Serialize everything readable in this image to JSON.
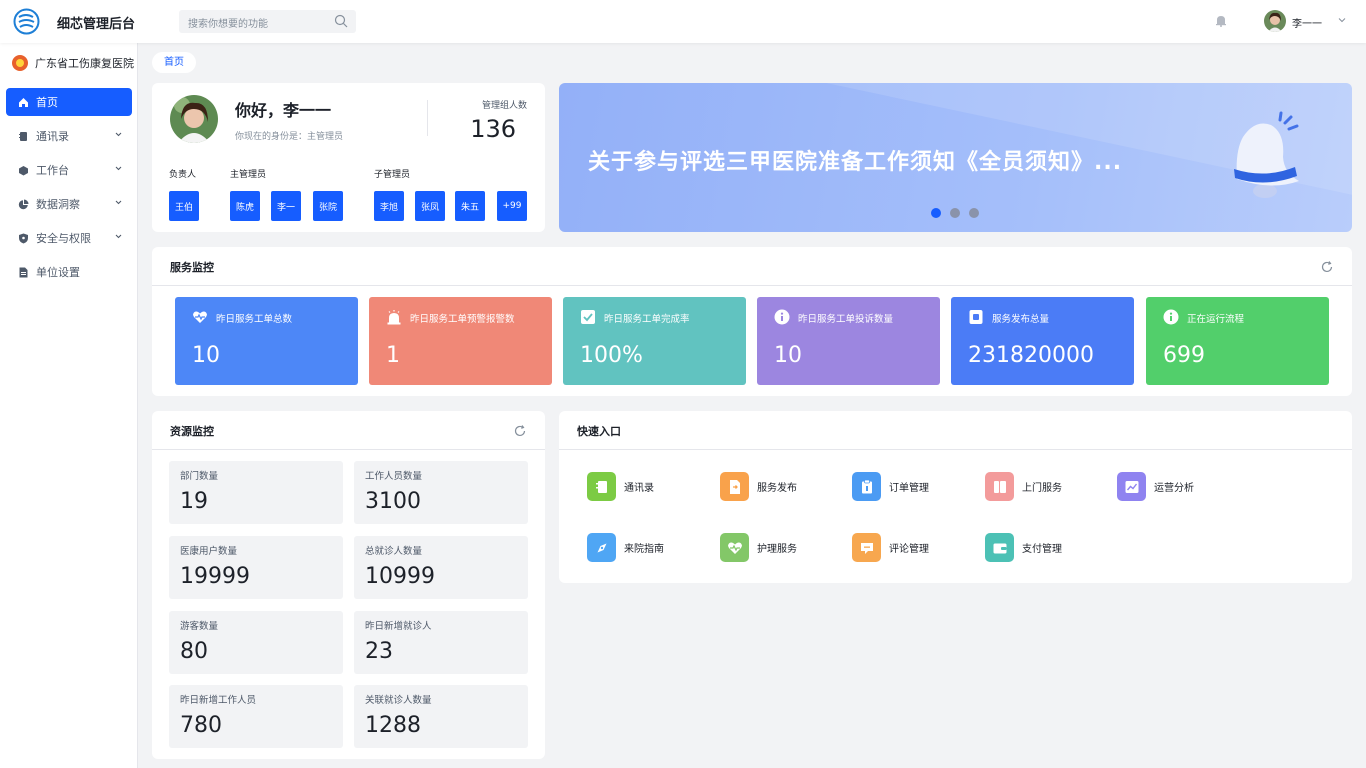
{
  "app": {
    "title": "细芯管理后台"
  },
  "search": {
    "placeholder": "搜索你想要的功能"
  },
  "user": {
    "name": "李一一"
  },
  "sidebar": {
    "org": "广东省工伤康复医院",
    "items": [
      {
        "label": "首页",
        "icon": "home-icon",
        "active": true
      },
      {
        "label": "通讯录",
        "icon": "contacts-icon",
        "expandable": true
      },
      {
        "label": "工作台",
        "icon": "cube-icon",
        "expandable": true
      },
      {
        "label": "数据洞察",
        "icon": "pie-chart-icon",
        "expandable": true
      },
      {
        "label": "安全与权限",
        "icon": "shield-icon",
        "expandable": true
      },
      {
        "label": "单位设置",
        "icon": "document-icon"
      }
    ]
  },
  "breadcrumb": {
    "home": "首页"
  },
  "welcome": {
    "greeting": "你好，李一一",
    "identity": "你现在的身份是：主管理员",
    "manager_count_label": "管理组人数",
    "manager_count": "136",
    "roles": {
      "owner_label": "负责人",
      "owners": [
        "王伯"
      ],
      "main_admin_label": "主管理员",
      "main_admins": [
        "陈虎",
        "李一",
        "张院"
      ],
      "sub_admin_label": "子管理员",
      "sub_admins": [
        "李旭",
        "张凤",
        "朱五",
        "+99"
      ]
    }
  },
  "banner": {
    "title": "关于参与评选三甲医院准备工作须知《全员须知》...",
    "dots": 3,
    "active_dot": 1
  },
  "service_monitor": {
    "title": "服务监控",
    "tiles": [
      {
        "label": "昨日服务工单总数",
        "value": "10",
        "color": "#4d87f7",
        "icon": "heart-icon"
      },
      {
        "label": "昨日服务工单预警报警数",
        "value": "1",
        "color": "#f08877",
        "icon": "alarm-icon"
      },
      {
        "label": "昨日服务工单完成率",
        "value": "100%",
        "color": "#61c3c0",
        "icon": "check-icon"
      },
      {
        "label": "昨日服务工单投诉数量",
        "value": "10",
        "color": "#9c86e0",
        "icon": "info-icon"
      },
      {
        "label": "服务发布总量",
        "value": "231820000",
        "color": "#4b7cf6",
        "icon": "file-icon"
      },
      {
        "label": "正在运行流程",
        "value": "699",
        "color": "#52cf6b",
        "icon": "info-icon"
      }
    ]
  },
  "resource_monitor": {
    "title": "资源监控",
    "items": [
      {
        "label": "部门数量",
        "value": "19"
      },
      {
        "label": "工作人员数量",
        "value": "3100"
      },
      {
        "label": "医康用户数量",
        "value": "19999"
      },
      {
        "label": "总就诊人数量",
        "value": "10999"
      },
      {
        "label": "游客数量",
        "value": "80"
      },
      {
        "label": "昨日新增就诊人",
        "value": "23"
      },
      {
        "label": "昨日新增工作人员",
        "value": "780"
      },
      {
        "label": "关联就诊人数量",
        "value": "1288"
      }
    ]
  },
  "quick_access": {
    "title": "快速入口",
    "items": [
      {
        "label": "通讯录",
        "color": "#7ccb44",
        "icon": "book-icon"
      },
      {
        "label": "服务发布",
        "color": "#f9a24b",
        "icon": "publish-icon"
      },
      {
        "label": "订单管理",
        "color": "#4b9bf3",
        "icon": "order-icon"
      },
      {
        "label": "上门服务",
        "color": "#f39b9b",
        "icon": "door-icon"
      },
      {
        "label": "运营分析",
        "color": "#8f83f0",
        "icon": "chart-icon"
      },
      {
        "label": "来院指南",
        "color": "#4fa6f4",
        "icon": "compass-icon"
      },
      {
        "label": "护理服务",
        "color": "#83c768",
        "icon": "care-icon"
      },
      {
        "label": "评论管理",
        "color": "#f7a74f",
        "icon": "comment-icon"
      },
      {
        "label": "支付管理",
        "color": "#4cc1b5",
        "icon": "wallet-icon"
      }
    ]
  }
}
